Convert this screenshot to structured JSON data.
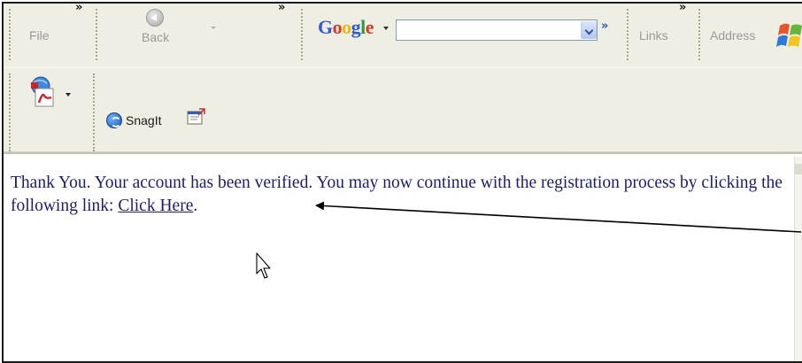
{
  "toolbar": {
    "file_label": "File",
    "back_label": "Back",
    "google_logo": [
      "G",
      "o",
      "o",
      "g",
      "l",
      "e"
    ],
    "google_search_value": "",
    "links_label": "Links",
    "address_label": "Address",
    "snagit_label": "SnagIt"
  },
  "page": {
    "message_text": "Thank You. Your account has been verified. You may now continue with the registration process by clicking the following link: ",
    "link_text": "Click Here",
    "after_link": "."
  },
  "icons": {
    "back": "back-arrow-icon",
    "google_dropdown": "chevron-down-icon",
    "google_go": "double-chevron-right-icon",
    "windows": "windows-logo-icon",
    "acrobat": "acrobat-pdf-icon",
    "snagit": "snagit-icon",
    "capture": "capture-icon",
    "cursor": "mouse-pointer-icon"
  },
  "colors": {
    "toolbar_bg": "#efeee3",
    "text": "#1c1c70",
    "google_blue": "#2d5bd8"
  }
}
